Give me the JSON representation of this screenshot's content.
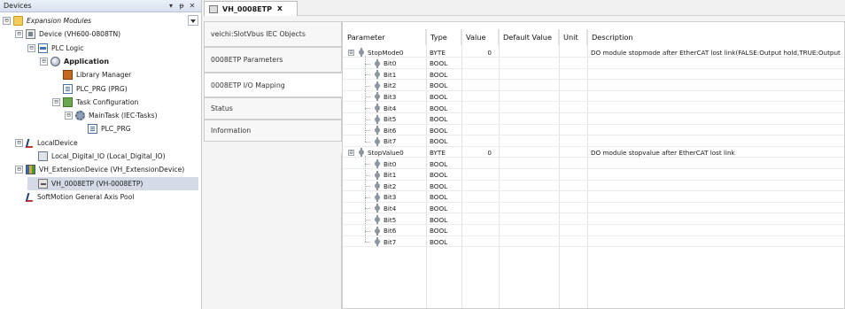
{
  "devices_panel": {
    "title": "Devices",
    "header_buttons": [
      "▾",
      "ᵽ",
      "✕"
    ],
    "tree": [
      {
        "label": "Expansion Modules",
        "icon": "folder-icon",
        "level": 0,
        "expander": "⊟",
        "style": "italic"
      },
      {
        "label": "Device (VH600-0808TN)",
        "icon": "device-icon",
        "level": 1,
        "expander": "⊟"
      },
      {
        "label": "PLC Logic",
        "icon": "plc-logic-icon",
        "level": 2,
        "expander": "⊟"
      },
      {
        "label": "Application",
        "icon": "application-icon",
        "level": 3,
        "expander": "⊟",
        "style": "bold"
      },
      {
        "label": "Library Manager",
        "icon": "library-manager-icon",
        "level": 4,
        "expander": ""
      },
      {
        "label": "PLC_PRG (PRG)",
        "icon": "program-icon",
        "level": 4,
        "expander": ""
      },
      {
        "label": "Task Configuration",
        "icon": "task-configuration-icon",
        "level": 4,
        "expander": "⊟"
      },
      {
        "label": "MainTask (IEC-Tasks)",
        "icon": "task-gear-icon",
        "level": 5,
        "expander": "⊟"
      },
      {
        "label": "PLC_PRG",
        "icon": "program-call-icon",
        "level": 6,
        "expander": ""
      },
      {
        "label": "LocalDevice",
        "icon": "local-device-icon",
        "level": 1,
        "expander": "⊟"
      },
      {
        "label": "Local_Digital_IO (Local_Digital_IO)",
        "icon": "digital-io-icon",
        "level": 2,
        "expander": ""
      },
      {
        "label": "VH_ExtensionDevice (VH_ExtensionDevice)",
        "icon": "extension-device-icon",
        "level": 1,
        "expander": "⊟"
      },
      {
        "label": "VH_0008ETP (VH-0008ETP)",
        "icon": "io-module-icon",
        "level": 2,
        "expander": "",
        "selected": true
      },
      {
        "label": "SoftMotion General Axis Pool",
        "icon": "softmotion-icon",
        "level": 1,
        "expander": ""
      }
    ]
  },
  "editor": {
    "tab": {
      "label": "VH_0008ETP",
      "close": "x"
    },
    "side_tabs": [
      {
        "label": "veichi:SlotVbus IEC Objects",
        "active": false
      },
      {
        "label": "0008ETP Parameters",
        "active": false
      },
      {
        "label": "0008ETP I/O Mapping",
        "active": true
      },
      {
        "label": "Status",
        "active": false
      },
      {
        "label": "Information",
        "active": false
      }
    ],
    "columns": [
      "Parameter",
      "Type",
      "Value",
      "Default Value",
      "Unit",
      "Description"
    ],
    "rows": [
      {
        "name": "StopMode0",
        "type": "BYTE",
        "value": "0",
        "default": "",
        "unit": "",
        "description": "DO module stopmode after EtherCAT lost link(FALSE:Output hold,TRUE:Output",
        "group": true,
        "expander": "⊟"
      },
      {
        "name": "Bit0",
        "type": "BOOL",
        "value": "",
        "default": "",
        "unit": "",
        "description": "",
        "group": false
      },
      {
        "name": "Bit1",
        "type": "BOOL",
        "value": "",
        "default": "",
        "unit": "",
        "description": "",
        "group": false
      },
      {
        "name": "Bit2",
        "type": "BOOL",
        "value": "",
        "default": "",
        "unit": "",
        "description": "",
        "group": false
      },
      {
        "name": "Bit3",
        "type": "BOOL",
        "value": "",
        "default": "",
        "unit": "",
        "description": "",
        "group": false
      },
      {
        "name": "Bit4",
        "type": "BOOL",
        "value": "",
        "default": "",
        "unit": "",
        "description": "",
        "group": false
      },
      {
        "name": "Bit5",
        "type": "BOOL",
        "value": "",
        "default": "",
        "unit": "",
        "description": "",
        "group": false
      },
      {
        "name": "Bit6",
        "type": "BOOL",
        "value": "",
        "default": "",
        "unit": "",
        "description": "",
        "group": false
      },
      {
        "name": "Bit7",
        "type": "BOOL",
        "value": "",
        "default": "",
        "unit": "",
        "description": "",
        "group": false
      },
      {
        "name": "StopValue0",
        "type": "BYTE",
        "value": "0",
        "default": "",
        "unit": "",
        "description": "DO module stopvalue after EtherCAT lost link",
        "group": true,
        "expander": "⊟"
      },
      {
        "name": "Bit0",
        "type": "BOOL",
        "value": "",
        "default": "",
        "unit": "",
        "description": "",
        "group": false
      },
      {
        "name": "Bit1",
        "type": "BOOL",
        "value": "",
        "default": "",
        "unit": "",
        "description": "",
        "group": false
      },
      {
        "name": "Bit2",
        "type": "BOOL",
        "value": "",
        "default": "",
        "unit": "",
        "description": "",
        "group": false
      },
      {
        "name": "Bit3",
        "type": "BOOL",
        "value": "",
        "default": "",
        "unit": "",
        "description": "",
        "group": false
      },
      {
        "name": "Bit4",
        "type": "BOOL",
        "value": "",
        "default": "",
        "unit": "",
        "description": "",
        "group": false
      },
      {
        "name": "Bit5",
        "type": "BOOL",
        "value": "",
        "default": "",
        "unit": "",
        "description": "",
        "group": false
      },
      {
        "name": "Bit6",
        "type": "BOOL",
        "value": "",
        "default": "",
        "unit": "",
        "description": "",
        "group": false
      },
      {
        "name": "Bit7",
        "type": "BOOL",
        "value": "",
        "default": "",
        "unit": "",
        "description": "",
        "group": false
      }
    ]
  }
}
